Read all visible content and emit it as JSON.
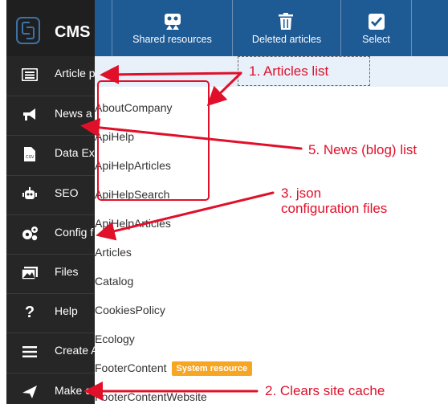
{
  "app": {
    "logo_text": "CMS"
  },
  "sidebar": {
    "items": [
      {
        "icon": "list-icon",
        "label": "Article p"
      },
      {
        "icon": "megaphone-icon",
        "label": "News a"
      },
      {
        "icon": "csv-file-icon",
        "label": "Data Ex"
      },
      {
        "icon": "robot-icon",
        "label": "SEO"
      },
      {
        "icon": "gears-icon",
        "label": "Config f"
      },
      {
        "icon": "images-icon",
        "label": "Files"
      },
      {
        "icon": "question-icon",
        "label": "Help"
      },
      {
        "icon": "hamburger-icon",
        "label": "Create A"
      },
      {
        "icon": "paper-plane-icon",
        "label": "Make c"
      }
    ]
  },
  "toolbar": {
    "shared_resources": "Shared resources",
    "deleted_articles": "Deleted articles",
    "select": "Select"
  },
  "files": [
    {
      "name": "AboutCompany"
    },
    {
      "name": "ApiHelp"
    },
    {
      "name": "ApiHelpArticles"
    },
    {
      "name": "ApiHelpSearch"
    },
    {
      "name": "ApiHelpArticles"
    },
    {
      "name": "Articles"
    },
    {
      "name": "Catalog"
    },
    {
      "name": "CookiesPolicy"
    },
    {
      "name": "Ecology"
    },
    {
      "name": "FooterContent",
      "badge": "System resource"
    },
    {
      "name": "FooterContentWebsite"
    }
  ],
  "annotations": {
    "a1": "1. Articles list",
    "a5": "5. News (blog) list",
    "a3_line1": "3. json",
    "a3_line2": "configuration files",
    "a2": "2. Clears site cache"
  },
  "colors": {
    "sidebar_bg": "#262626",
    "toolbar_bg": "#1e5a94",
    "annotation_red": "#e0102a",
    "badge_orange": "#f6a623"
  }
}
